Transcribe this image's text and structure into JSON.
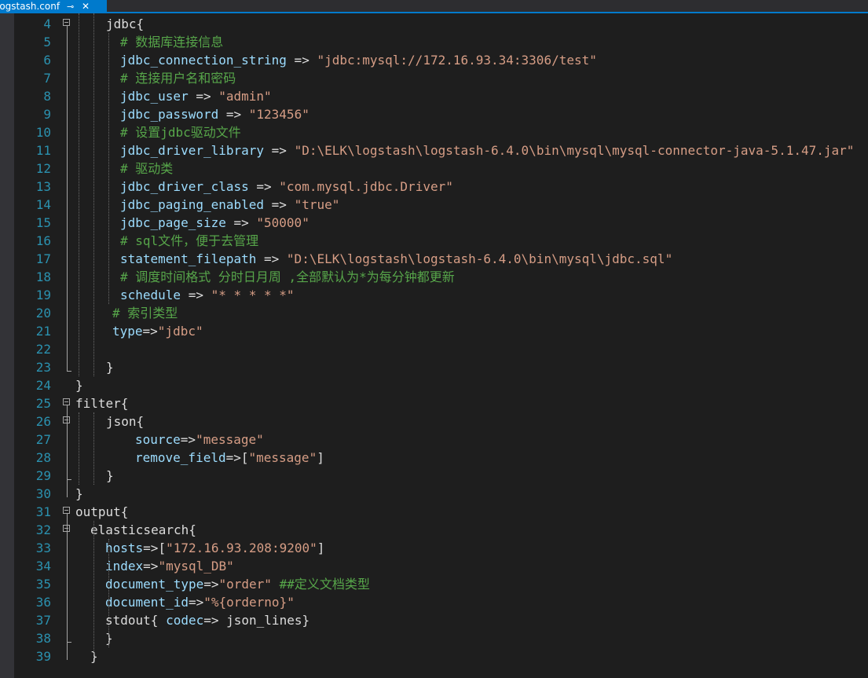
{
  "tab": {
    "title": "logstash.conf",
    "pin_glyph": "⊸",
    "close_glyph": "✕"
  },
  "colors": {
    "background": "#1e1e1e",
    "line_number": "#2b91af",
    "keyword": "#9cdcfe",
    "string": "#d69d85",
    "comment": "#57a64a",
    "plain": "#dcdcdc",
    "tab_accent": "#007acc"
  },
  "lines": [
    {
      "n": "4",
      "fold": true,
      "segs": [
        {
          "t": "jdbc{",
          "c": "pl"
        }
      ]
    },
    {
      "n": "5",
      "segs": [
        {
          "t": "# 数据库连接信息",
          "c": "cm"
        }
      ]
    },
    {
      "n": "6",
      "segs": [
        {
          "t": "jdbc_connection_string",
          "c": "key"
        },
        {
          "t": " => ",
          "c": "pl"
        },
        {
          "t": "\"jdbc:mysql://172.16.93.34:3306/test\"",
          "c": "str"
        }
      ]
    },
    {
      "n": "7",
      "segs": [
        {
          "t": "# 连接用户名和密码",
          "c": "cm"
        }
      ]
    },
    {
      "n": "8",
      "segs": [
        {
          "t": "jdbc_user",
          "c": "key"
        },
        {
          "t": " => ",
          "c": "pl"
        },
        {
          "t": "\"admin\"",
          "c": "str"
        }
      ]
    },
    {
      "n": "9",
      "segs": [
        {
          "t": "jdbc_password",
          "c": "key"
        },
        {
          "t": " => ",
          "c": "pl"
        },
        {
          "t": "\"123456\"",
          "c": "str"
        }
      ]
    },
    {
      "n": "10",
      "segs": [
        {
          "t": "# 设置jdbc驱动文件",
          "c": "cm"
        }
      ]
    },
    {
      "n": "11",
      "segs": [
        {
          "t": "jdbc_driver_library",
          "c": "key"
        },
        {
          "t": " => ",
          "c": "pl"
        },
        {
          "t": "\"D:\\ELK\\logstash\\logstash-6.4.0\\bin\\mysql\\mysql-connector-java-5.1.47.jar\"",
          "c": "str"
        }
      ]
    },
    {
      "n": "12",
      "segs": [
        {
          "t": "# 驱动类",
          "c": "cm"
        }
      ]
    },
    {
      "n": "13",
      "segs": [
        {
          "t": "jdbc_driver_class",
          "c": "key"
        },
        {
          "t": " => ",
          "c": "pl"
        },
        {
          "t": "\"com.mysql.jdbc.Driver\"",
          "c": "str"
        }
      ]
    },
    {
      "n": "14",
      "segs": [
        {
          "t": "jdbc_paging_enabled",
          "c": "key"
        },
        {
          "t": " => ",
          "c": "pl"
        },
        {
          "t": "\"true\"",
          "c": "str"
        }
      ]
    },
    {
      "n": "15",
      "segs": [
        {
          "t": "jdbc_page_size",
          "c": "key"
        },
        {
          "t": " => ",
          "c": "pl"
        },
        {
          "t": "\"50000\"",
          "c": "str"
        }
      ]
    },
    {
      "n": "16",
      "segs": [
        {
          "t": "# sql文件，便于去管理",
          "c": "cm"
        }
      ]
    },
    {
      "n": "17",
      "segs": [
        {
          "t": "statement_filepath",
          "c": "key"
        },
        {
          "t": " => ",
          "c": "pl"
        },
        {
          "t": "\"D:\\ELK\\logstash\\logstash-6.4.0\\bin\\mysql\\jdbc.sql\"",
          "c": "str"
        }
      ]
    },
    {
      "n": "18",
      "segs": [
        {
          "t": "# 调度时间格式 分时日月周 ,全部默认为*为每分钟都更新",
          "c": "cm"
        }
      ]
    },
    {
      "n": "19",
      "segs": [
        {
          "t": "schedule",
          "c": "key"
        },
        {
          "t": " => ",
          "c": "pl"
        },
        {
          "t": "\"* * * * *\"",
          "c": "str"
        }
      ]
    },
    {
      "n": "20",
      "segs": [
        {
          "t": "# 索引类型",
          "c": "cm"
        }
      ]
    },
    {
      "n": "21",
      "segs": [
        {
          "t": "type",
          "c": "key"
        },
        {
          "t": "=>",
          "c": "pl"
        },
        {
          "t": "\"jdbc\"",
          "c": "str"
        }
      ]
    },
    {
      "n": "22",
      "segs": []
    },
    {
      "n": "23",
      "segs": [
        {
          "t": "}",
          "c": "pl"
        }
      ]
    },
    {
      "n": "24",
      "segs": [
        {
          "t": "}",
          "c": "pl"
        }
      ]
    },
    {
      "n": "25",
      "fold": true,
      "segs": [
        {
          "t": "filter{",
          "c": "pl"
        }
      ]
    },
    {
      "n": "26",
      "fold": true,
      "segs": [
        {
          "t": "json{",
          "c": "pl"
        }
      ]
    },
    {
      "n": "27",
      "segs": [
        {
          "t": "source",
          "c": "key"
        },
        {
          "t": "=>",
          "c": "pl"
        },
        {
          "t": "\"message\"",
          "c": "str"
        }
      ]
    },
    {
      "n": "28",
      "segs": [
        {
          "t": "remove_field",
          "c": "key"
        },
        {
          "t": "=>[",
          "c": "pl"
        },
        {
          "t": "\"message\"",
          "c": "str"
        },
        {
          "t": "]",
          "c": "pl"
        }
      ]
    },
    {
      "n": "29",
      "segs": [
        {
          "t": "}",
          "c": "pl"
        }
      ]
    },
    {
      "n": "30",
      "segs": [
        {
          "t": "}",
          "c": "pl"
        }
      ]
    },
    {
      "n": "31",
      "fold": true,
      "segs": [
        {
          "t": "output{",
          "c": "pl"
        }
      ]
    },
    {
      "n": "32",
      "fold": true,
      "segs": [
        {
          "t": "elasticsearch{",
          "c": "pl"
        }
      ]
    },
    {
      "n": "33",
      "segs": [
        {
          "t": "hosts",
          "c": "key"
        },
        {
          "t": "=>[",
          "c": "pl"
        },
        {
          "t": "\"172.16.93.208:9200\"",
          "c": "str"
        },
        {
          "t": "]",
          "c": "pl"
        }
      ]
    },
    {
      "n": "34",
      "segs": [
        {
          "t": "index",
          "c": "key"
        },
        {
          "t": "=>",
          "c": "pl"
        },
        {
          "t": "\"mysql_DB\"",
          "c": "str"
        }
      ]
    },
    {
      "n": "35",
      "segs": [
        {
          "t": "document_type",
          "c": "key"
        },
        {
          "t": "=>",
          "c": "pl"
        },
        {
          "t": "\"order\"",
          "c": "str"
        },
        {
          "t": " ##定义文档类型",
          "c": "cm"
        }
      ]
    },
    {
      "n": "36",
      "segs": [
        {
          "t": "document_id",
          "c": "key"
        },
        {
          "t": "=>",
          "c": "pl"
        },
        {
          "t": "\"%{orderno}\"",
          "c": "str"
        }
      ]
    },
    {
      "n": "37",
      "segs": [
        {
          "t": "stdout{ ",
          "c": "pl"
        },
        {
          "t": "codec",
          "c": "key"
        },
        {
          "t": "=> json_lines}",
          "c": "pl"
        }
      ]
    },
    {
      "n": "38",
      "segs": [
        {
          "t": "}",
          "c": "pl"
        }
      ]
    },
    {
      "n": "39",
      "segs": [
        {
          "t": "}",
          "c": "pl"
        }
      ]
    }
  ]
}
